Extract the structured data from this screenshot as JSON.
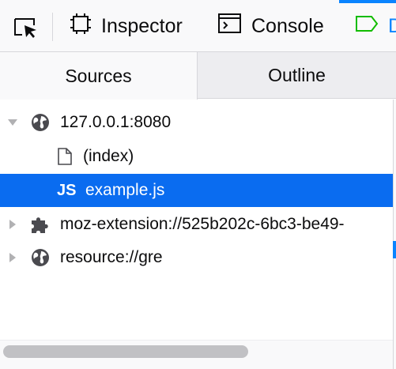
{
  "toolbar": {
    "picker_icon": "element-picker-icon",
    "tabs": [
      {
        "label": "Inspector",
        "icon": "inspector-icon"
      },
      {
        "label": "Console",
        "icon": "console-icon"
      },
      {
        "label": "D",
        "icon": "debugger-icon",
        "active": true
      }
    ]
  },
  "subtabs": {
    "sources": "Sources",
    "outline": "Outline",
    "active": "Sources"
  },
  "tree": {
    "items": [
      {
        "label": "127.0.0.1:8080",
        "icon": "globe-icon",
        "expanded": true
      },
      {
        "label": "(index)",
        "icon": "file-icon"
      },
      {
        "label": "example.js",
        "icon": "js-file-icon",
        "badge": "JS",
        "selected": true
      },
      {
        "label": "moz-extension://525b202c-6bc3-be49-",
        "icon": "extension-icon",
        "expanded": false
      },
      {
        "label": "resource://gre",
        "icon": "globe-icon",
        "expanded": false
      }
    ]
  },
  "colors": {
    "accent": "#0a84ff",
    "selection": "#0a6cf0",
    "debugger_icon": "#12bc00"
  }
}
